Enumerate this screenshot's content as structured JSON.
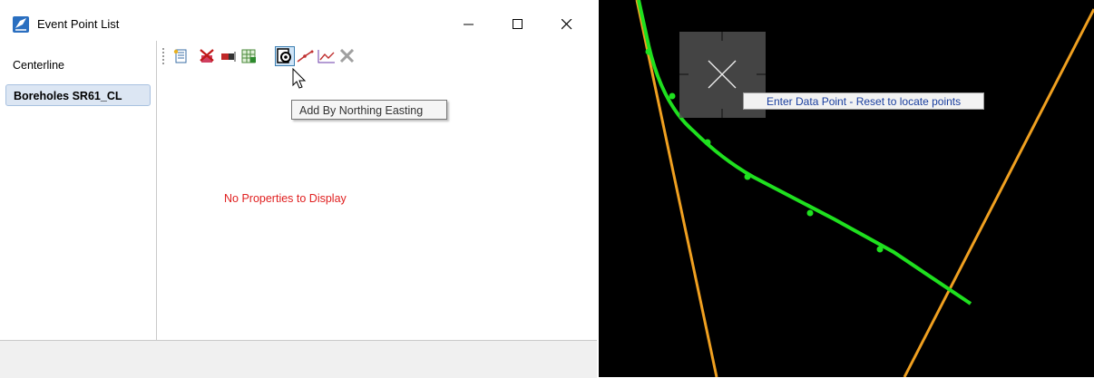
{
  "window": {
    "title": "Event Point List"
  },
  "sidebar": {
    "items": [
      {
        "label": "Centerline"
      },
      {
        "label": "Boreholes SR61_CL"
      }
    ]
  },
  "toolbar": {
    "buttons": [
      {
        "icon": "properties-list-icon"
      },
      {
        "icon": "delete-point-icon"
      },
      {
        "icon": "eraser-icon"
      },
      {
        "icon": "table-import-icon"
      },
      {
        "icon": "add-by-northing-easting-icon"
      },
      {
        "icon": "add-by-station-offset-icon"
      },
      {
        "icon": "profile-icon"
      },
      {
        "icon": "close-x-icon"
      }
    ],
    "tooltip": "Add By Northing Easting"
  },
  "main": {
    "empty_message": "No Properties to Display"
  },
  "cad_view": {
    "prompt": "Enter Data Point - Reset to locate points",
    "colors": {
      "background": "#000000",
      "alignment": "#1fe01f",
      "road_edges": "#f0a020"
    }
  }
}
